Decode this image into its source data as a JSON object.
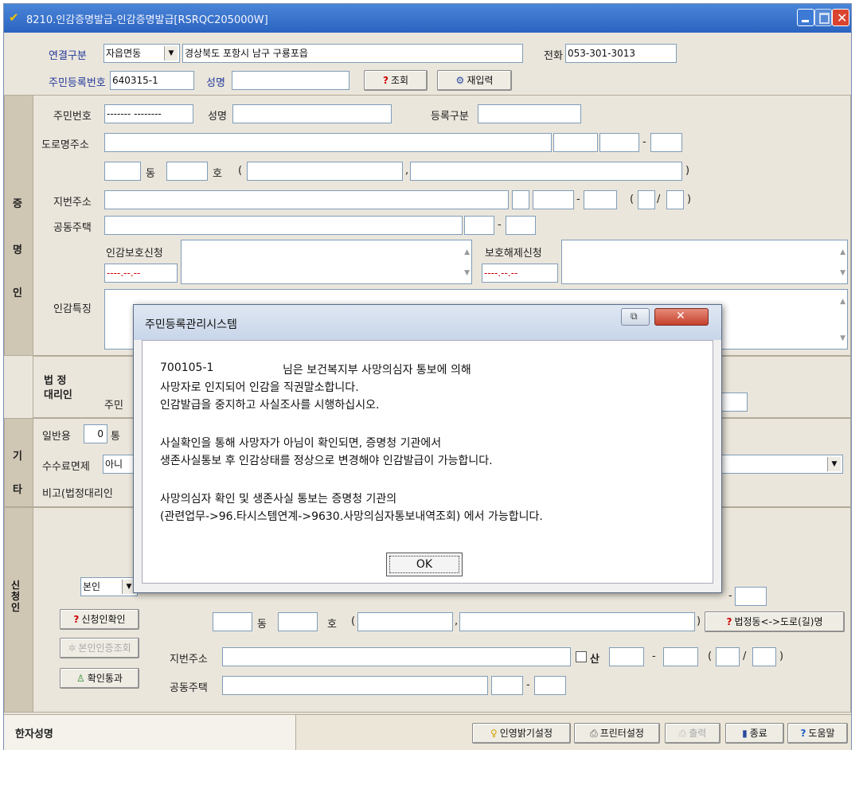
{
  "window": {
    "title": "8210.인감증명발급-인감증명발급[RSRQC205000W]"
  },
  "header": {
    "connection_label": "연결구분",
    "connection_value": "자읍면동",
    "address_value": "경상북도 포항시 남구 구룡포읍",
    "phone_label": "전화",
    "phone_value": "053-301-3013",
    "rrn_label": "주민등록번호",
    "rrn_value": "640315-1",
    "name_label": "성명",
    "name_value": "",
    "search_button": "조회",
    "reset_button": "재입력"
  },
  "cert": {
    "side_chars": [
      "증",
      "명",
      "인"
    ],
    "rrn_label": "주민번호",
    "rrn_value": "------- --------",
    "name_label": "성명",
    "reg_label": "등록구분",
    "road_label": "도로명주소",
    "dong": "동",
    "ho": "호",
    "paren_open": "(",
    "paren_close": ")",
    "comma": ",",
    "dash": "-",
    "slash": "/",
    "jibun_label": "지번주소",
    "apt_label": "공동주택",
    "protect_label": "인감보호신청",
    "protect_date": "----.--.--",
    "unprotect_label": "보호해제신청",
    "unprotect_date": "----.--.--",
    "feature_label": "인감특징"
  },
  "legal": {
    "label1": "법 정",
    "label2": "대리인",
    "rrn_label": "주민"
  },
  "etc": {
    "side_chars": [
      "기",
      "타"
    ],
    "general_label": "일반용",
    "general_value": "0",
    "copies_unit": "통",
    "fee_label": "수수료면제",
    "fee_value": "아니",
    "note_label": "비고(법정대리인"
  },
  "applicant": {
    "side_label": "신청인",
    "relation_value": "본인",
    "check_button": "신청인확인",
    "id_button": "본인인증조회",
    "pass_button": "확인통과",
    "road_toggle_button": "법정동<->도로(길)명",
    "jibun_label": "지번주소",
    "san_label": "산",
    "apt_label": "공동주택"
  },
  "bottom": {
    "hanja_label": "한자성명",
    "seal_button": "인영밝기설정",
    "printer_button": "프린터설정",
    "print_button": "출력",
    "exit_button": "종료",
    "help_button": "도움말"
  },
  "dialog": {
    "title": "주민등록관리시스템",
    "line1_rrn": "700105-1",
    "line1_rest": "님은 보건복지부 사망의심자 통보에 의해",
    "line2": "사망자로 인지되어 인감을 직권말소합니다.",
    "line3": "인감발급을 중지하고 사실조사를 시행하십시오.",
    "line4": "사실확인을 통해 사망자가 아님이 확인되면, 증명청 기관에서",
    "line5": "생존사실통보 후 인감상태를 정상으로 변경해야 인감발급이 가능합니다.",
    "line6": "사망의심자 확인 및 생존사실 통보는 증명청 기관의",
    "line7": "(관련업무->96.타시스템연계->9630.사망의심자통보내역조회) 에서 가능합니다.",
    "ok_button": "OK"
  },
  "colors": {
    "titlebar": "#2b64c0",
    "close": "#d9432f",
    "panel": "#ebe6dc",
    "label_blue": "#223a9a",
    "date_red": "#cc0000"
  }
}
